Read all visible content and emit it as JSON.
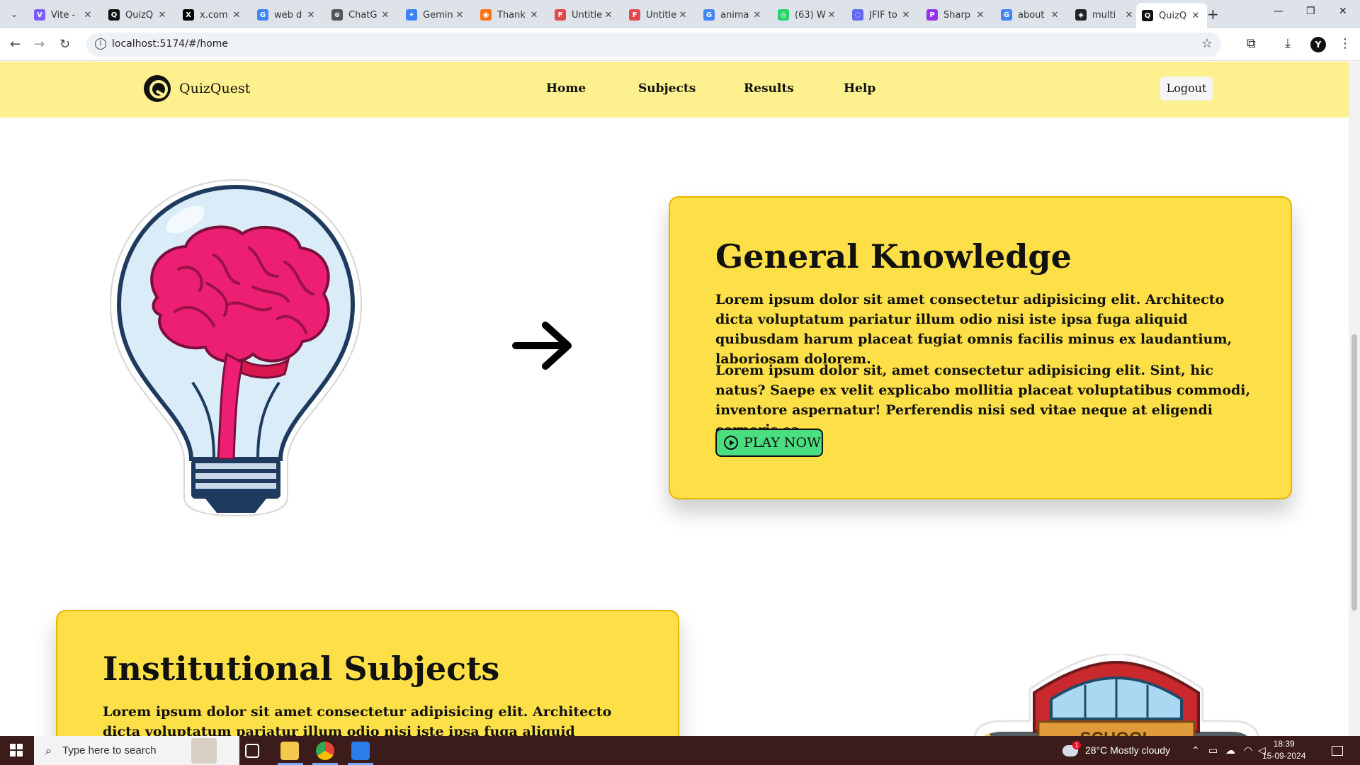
{
  "browser": {
    "tabs": [
      {
        "title": "Vite -",
        "fav_color": "#7c5cff",
        "fav_glyph": "V"
      },
      {
        "title": "QuizQ",
        "fav_color": "#111111",
        "fav_glyph": "Q"
      },
      {
        "title": "x.com",
        "fav_color": "#000000",
        "fav_glyph": "X"
      },
      {
        "title": "web d",
        "fav_color": "#4285f4",
        "fav_glyph": "G"
      },
      {
        "title": "ChatG",
        "fav_color": "#555555",
        "fav_glyph": "⊛"
      },
      {
        "title": "Gemin",
        "fav_color": "#3b82f6",
        "fav_glyph": "✦"
      },
      {
        "title": "Thank",
        "fav_color": "#f97316",
        "fav_glyph": "◉"
      },
      {
        "title": "Untitle",
        "fav_color": "#e2494d",
        "fav_glyph": "F"
      },
      {
        "title": "Untitle",
        "fav_color": "#e2494d",
        "fav_glyph": "F"
      },
      {
        "title": "anima",
        "fav_color": "#4285f4",
        "fav_glyph": "G"
      },
      {
        "title": "(63) W",
        "fav_color": "#25d366",
        "fav_glyph": "◎"
      },
      {
        "title": "JFIF to",
        "fav_color": "#6366f1",
        "fav_glyph": "◌"
      },
      {
        "title": "Sharp",
        "fav_color": "#9333ea",
        "fav_glyph": "P"
      },
      {
        "title": "about",
        "fav_color": "#4285f4",
        "fav_glyph": "G"
      },
      {
        "title": "multi",
        "fav_color": "#222222",
        "fav_glyph": "◈"
      },
      {
        "title": "QuizQ",
        "fav_color": "#111111",
        "fav_glyph": "Q"
      }
    ],
    "url": "localhost:5174/#/home"
  },
  "site": {
    "logo_text": "QuizQuest",
    "nav": [
      "Home",
      "Subjects",
      "Results",
      "Help"
    ],
    "logout_label": "Logout",
    "header_color": "#fdf08f"
  },
  "cards": {
    "gk": {
      "title": "General Knowledge",
      "p1": "Lorem ipsum dolor sit amet consectetur adipisicing elit. Architecto dicta voluptatum pariatur illum odio nisi iste ipsa fuga aliquid quibusdam harum placeat fugiat omnis facilis minus ex laudantium, laboriosam dolorem.",
      "p2": "Lorem ipsum dolor sit, amet consectetur adipisicing elit. Sint, hic natus? Saepe ex velit explicabo mollitia placeat voluptatibus commodi, inventore aspernatur! Perferendis nisi sed vitae neque at eligendi corporis ea.",
      "button_label": "PLAY NOW"
    },
    "inst": {
      "title": "Institutional Subjects",
      "p1": "Lorem ipsum dolor sit amet consectetur adipisicing elit. Architecto dicta voluptatum pariatur illum odio nisi iste ipsa fuga aliquid quibusdam harum"
    },
    "card_color": "#fde047",
    "button_color": "#4ade80"
  },
  "school_sign": "SCHOOL",
  "taskbar": {
    "search_placeholder": "Type here to search",
    "weather": "28°C  Mostly cloudy",
    "weather_badge": "1",
    "time": "18:39",
    "date": "15-09-2024"
  }
}
